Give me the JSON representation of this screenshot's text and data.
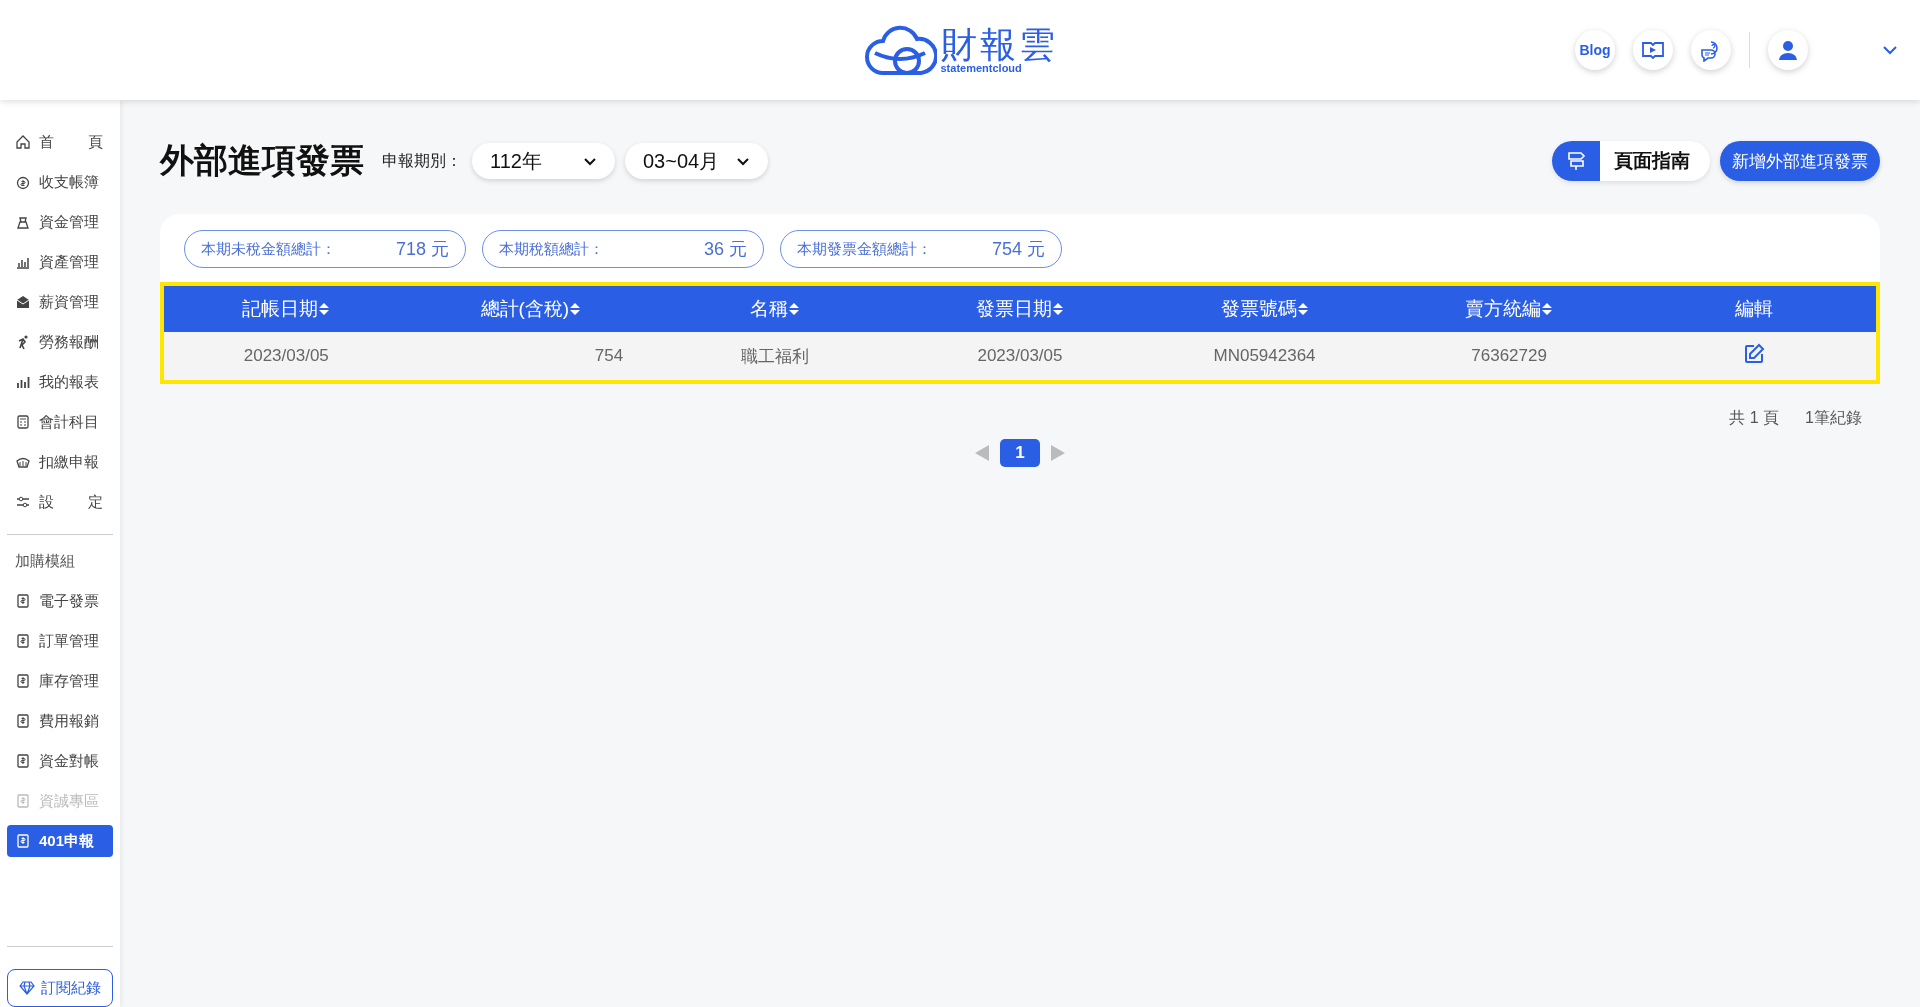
{
  "header": {
    "logo_title": "財報雲",
    "logo_subtitle": "statementcloud",
    "blog": "Blog"
  },
  "sidebar": {
    "items": [
      {
        "label": "首 頁",
        "selected": false,
        "disabled": false
      },
      {
        "label": "收支帳簿",
        "selected": false,
        "disabled": false
      },
      {
        "label": "資金管理",
        "selected": false,
        "disabled": false
      },
      {
        "label": "資產管理",
        "selected": false,
        "disabled": false
      },
      {
        "label": "薪資管理",
        "selected": false,
        "disabled": false
      },
      {
        "label": "勞務報酬",
        "selected": false,
        "disabled": false
      },
      {
        "label": "我的報表",
        "selected": false,
        "disabled": false
      },
      {
        "label": "會計科目",
        "selected": false,
        "disabled": false
      },
      {
        "label": "扣繳申報",
        "selected": false,
        "disabled": false
      },
      {
        "label": "設 定",
        "selected": false,
        "disabled": false
      }
    ],
    "addon_title": "加購模組",
    "addons": [
      {
        "label": "電子發票",
        "selected": false,
        "disabled": false
      },
      {
        "label": "訂單管理",
        "selected": false,
        "disabled": false
      },
      {
        "label": "庫存管理",
        "selected": false,
        "disabled": false
      },
      {
        "label": "費用報銷",
        "selected": false,
        "disabled": false
      },
      {
        "label": "資金對帳",
        "selected": false,
        "disabled": false
      },
      {
        "label": "資誠專區",
        "selected": false,
        "disabled": true
      },
      {
        "label": "401申報",
        "selected": true,
        "disabled": false
      }
    ],
    "subscription": "訂閱紀錄"
  },
  "page": {
    "title": "外部進項發票",
    "period_label": "申報期別：",
    "year": "112年",
    "months": "03~04月",
    "guide": "頁面指南",
    "add": "新增外部進項發票"
  },
  "summary": [
    {
      "label": "本期未稅金額總計：",
      "value": "718 元"
    },
    {
      "label": "本期稅額總計：",
      "value": "36 元"
    },
    {
      "label": "本期發票金額總計：",
      "value": "754 元"
    }
  ],
  "table": {
    "highlighted": true,
    "columns": [
      {
        "label": "記帳日期",
        "sortable": true
      },
      {
        "label": "總計(含稅)",
        "sortable": true
      },
      {
        "label": "名稱",
        "sortable": true
      },
      {
        "label": "發票日期",
        "sortable": true
      },
      {
        "label": "發票號碼",
        "sortable": true
      },
      {
        "label": "賣方統編",
        "sortable": true
      },
      {
        "label": "編輯",
        "sortable": false
      }
    ],
    "rows": [
      {
        "cells": [
          "2023/03/05",
          "754",
          "職工福利",
          "2023/03/05",
          "MN05942364",
          "76362729"
        ]
      }
    ]
  },
  "footer": {
    "pages": "共 1 頁",
    "records": "1筆紀錄"
  },
  "pagination": {
    "pages": [
      {
        "label": "1",
        "selected": true
      }
    ]
  }
}
